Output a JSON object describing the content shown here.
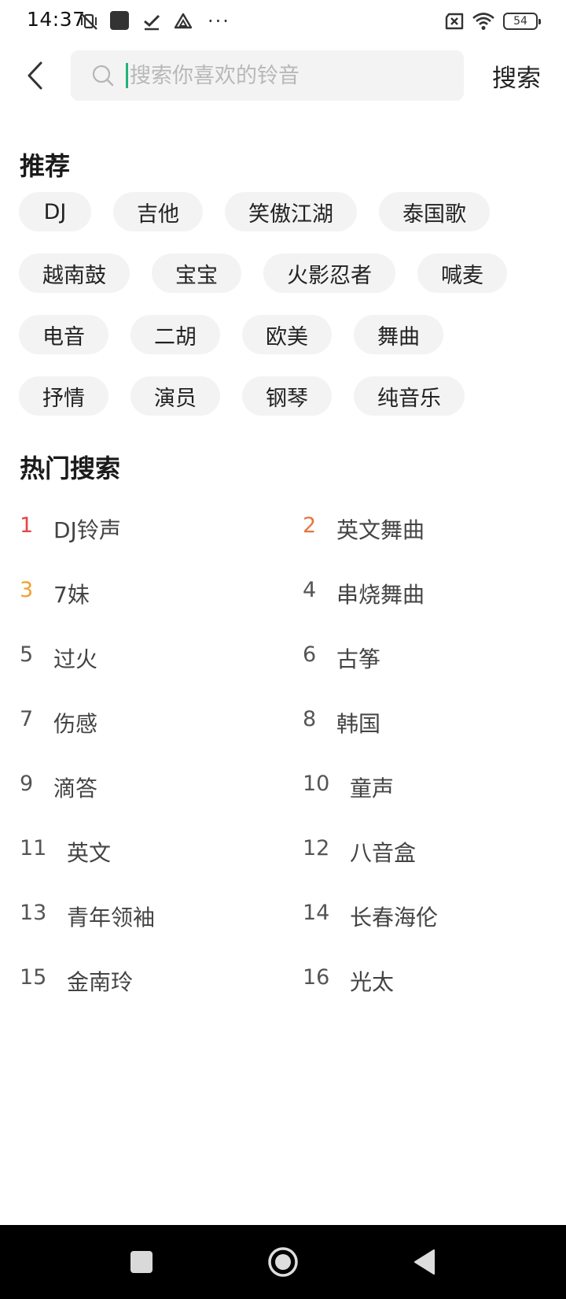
{
  "status_bar": {
    "time": "14:37",
    "battery": "54"
  },
  "search": {
    "placeholder": "搜索你喜欢的铃音",
    "value": "",
    "button_label": "搜索",
    "caret_color": "#21b37a"
  },
  "recommend": {
    "title": "推荐",
    "rows": [
      [
        "DJ",
        "吉他",
        "笑傲江湖",
        "泰国歌"
      ],
      [
        "越南鼓",
        "宝宝",
        "火影忍者",
        "喊麦"
      ],
      [
        "电音",
        "二胡",
        "欧美",
        "舞曲"
      ],
      [
        "抒情",
        "演员",
        "钢琴",
        "纯音乐"
      ]
    ]
  },
  "hot_search": {
    "title": "热门搜索",
    "rank_colors": {
      "1": "#e64545",
      "2": "#e8743f",
      "3": "#f0a030"
    },
    "items": [
      {
        "rank": "1",
        "label": "DJ铃声"
      },
      {
        "rank": "2",
        "label": "英文舞曲"
      },
      {
        "rank": "3",
        "label": "7妹"
      },
      {
        "rank": "4",
        "label": "串烧舞曲"
      },
      {
        "rank": "5",
        "label": "过火"
      },
      {
        "rank": "6",
        "label": "古筝"
      },
      {
        "rank": "7",
        "label": "伤感"
      },
      {
        "rank": "8",
        "label": "韩国"
      },
      {
        "rank": "9",
        "label": "滴答"
      },
      {
        "rank": "10",
        "label": "童声"
      },
      {
        "rank": "11",
        "label": "英文"
      },
      {
        "rank": "12",
        "label": "八音盒"
      },
      {
        "rank": "13",
        "label": "青年领袖"
      },
      {
        "rank": "14",
        "label": "长春海伦"
      },
      {
        "rank": "15",
        "label": "金南玲"
      },
      {
        "rank": "16",
        "label": "光太"
      }
    ]
  },
  "icons": {
    "status_left": [
      "mute-vibrate-icon",
      "app-square-icon",
      "check-icon",
      "drive-icon",
      "more-dots-icon"
    ],
    "status_right": [
      "no-sim-icon",
      "wifi-icon",
      "battery-icon"
    ],
    "header": [
      "back-arrow-icon",
      "search-icon"
    ],
    "nav": [
      "recents-icon",
      "home-icon",
      "back-icon"
    ]
  }
}
